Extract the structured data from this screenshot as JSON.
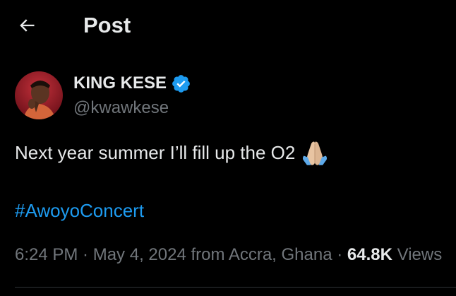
{
  "header": {
    "back_icon": "arrow-left-icon",
    "title": "Post"
  },
  "author": {
    "display_name": "KING KESE",
    "handle": "@kwawkese",
    "verified": true,
    "verified_icon": "verified-badge-icon",
    "avatar_icon": "profile-photo"
  },
  "tweet": {
    "text": "Next year summer I’ll fill up the O2",
    "emoji": "folded-hands-emoji",
    "hashtag": "#AwoyoConcert"
  },
  "meta": {
    "time": "6:24 PM",
    "separator_1": " · ",
    "date": "May 4, 2024",
    "location_prefix": " from ",
    "location": "Accra, Ghana",
    "separator_2": " · ",
    "views_count": "64.8K",
    "views_label": " Views"
  },
  "colors": {
    "background": "#000000",
    "text_primary": "#e7e9ea",
    "text_secondary": "#71767b",
    "accent": "#1d9bf0",
    "divider": "#2f3336"
  }
}
